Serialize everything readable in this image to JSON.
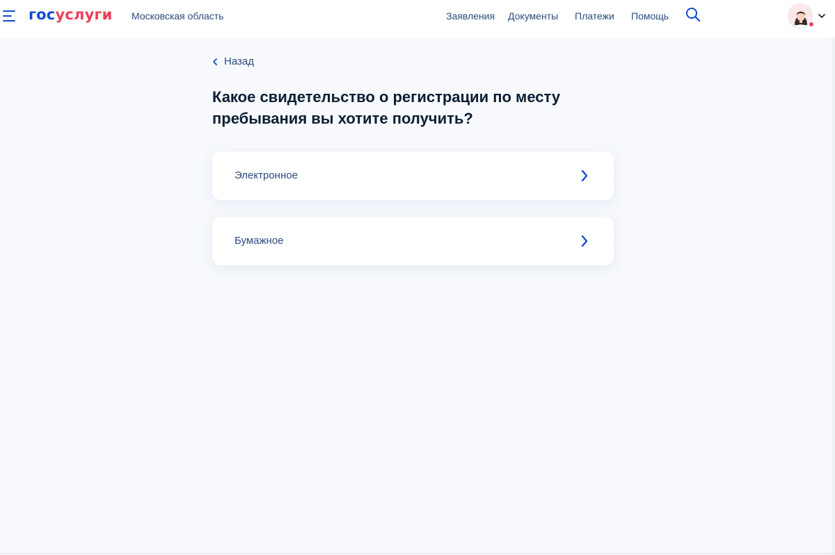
{
  "header": {
    "logo_part1": "гос",
    "logo_part2": "услуги",
    "region": "Московская область",
    "nav": [
      "Заявления",
      "Документы",
      "Платежи",
      "Помощь"
    ]
  },
  "main": {
    "back_label": "Назад",
    "question": "Какое свидетельство о регистрации по месту пребывания вы хотите получить?",
    "options": [
      {
        "label": "Электронное"
      },
      {
        "label": "Бумажное"
      }
    ]
  },
  "icons": {
    "menu": "hamburger-icon",
    "search": "search-icon",
    "avatar": "user-avatar",
    "dropdown": "chevron-down-icon",
    "back": "chevron-left-icon",
    "option": "chevron-right-icon"
  },
  "colors": {
    "brand_blue": "#0d4cd3",
    "brand_red": "#ee3f58",
    "background": "#f7f9fc",
    "text_link": "#2a4a7a"
  }
}
